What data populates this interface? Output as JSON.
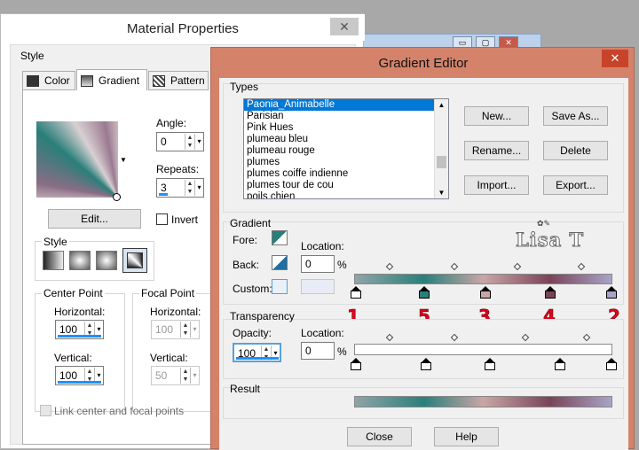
{
  "material": {
    "title": "Material Properties",
    "close": "✕",
    "style_label": "Style",
    "tabs": [
      {
        "label": "Color"
      },
      {
        "label": "Gradient"
      },
      {
        "label": "Pattern"
      }
    ],
    "angle_label": "Angle:",
    "angle_value": "0",
    "repeats_label": "Repeats:",
    "repeats_value": "3",
    "edit_button": "Edit...",
    "invert_label": "Invert",
    "style_group": "Style",
    "center_point": "Center Point",
    "focal_point": "Focal Point",
    "horizontal": "Horizontal:",
    "vertical": "Vertical:",
    "center_h": "100",
    "center_v": "100",
    "focal_h": "100",
    "focal_v": "50",
    "link_label": "Link center and focal points"
  },
  "editor": {
    "title": "Gradient Editor",
    "close": "✕",
    "types_label": "Types",
    "types": [
      "Paonia_Animabelle",
      "Parisian",
      "Pink Hues",
      "plumeau bleu",
      "plumeau rouge",
      "plumes",
      "plumes coiffe indienne",
      "plumes tour de cou",
      "poils chien"
    ],
    "buttons": {
      "new": "New...",
      "save_as": "Save As...",
      "rename": "Rename...",
      "delete": "Delete",
      "import": "Import...",
      "export": "Export..."
    },
    "gradient_label": "Gradient",
    "fore_label": "Fore:",
    "back_label": "Back:",
    "custom_label": "Custom:",
    "location_label": "Location:",
    "location_value": "0",
    "percent": "%",
    "transparency_label": "Transparency",
    "opacity_label": "Opacity:",
    "opacity_value": "100",
    "t_location_label": "Location:",
    "t_location_value": "0",
    "t_percent": "%",
    "result_label": "Result",
    "close_button": "Close",
    "help_button": "Help",
    "annotations": [
      "1",
      "5",
      "3",
      "4",
      "2"
    ],
    "watermark": "Lisa T"
  },
  "colors": {
    "teal": "#2a7f7a",
    "mauve": "#8f7a92",
    "pink": "#c9a6a6",
    "plum": "#7a4458",
    "lilac": "#a8a4c8",
    "accent": "#d4836a"
  }
}
